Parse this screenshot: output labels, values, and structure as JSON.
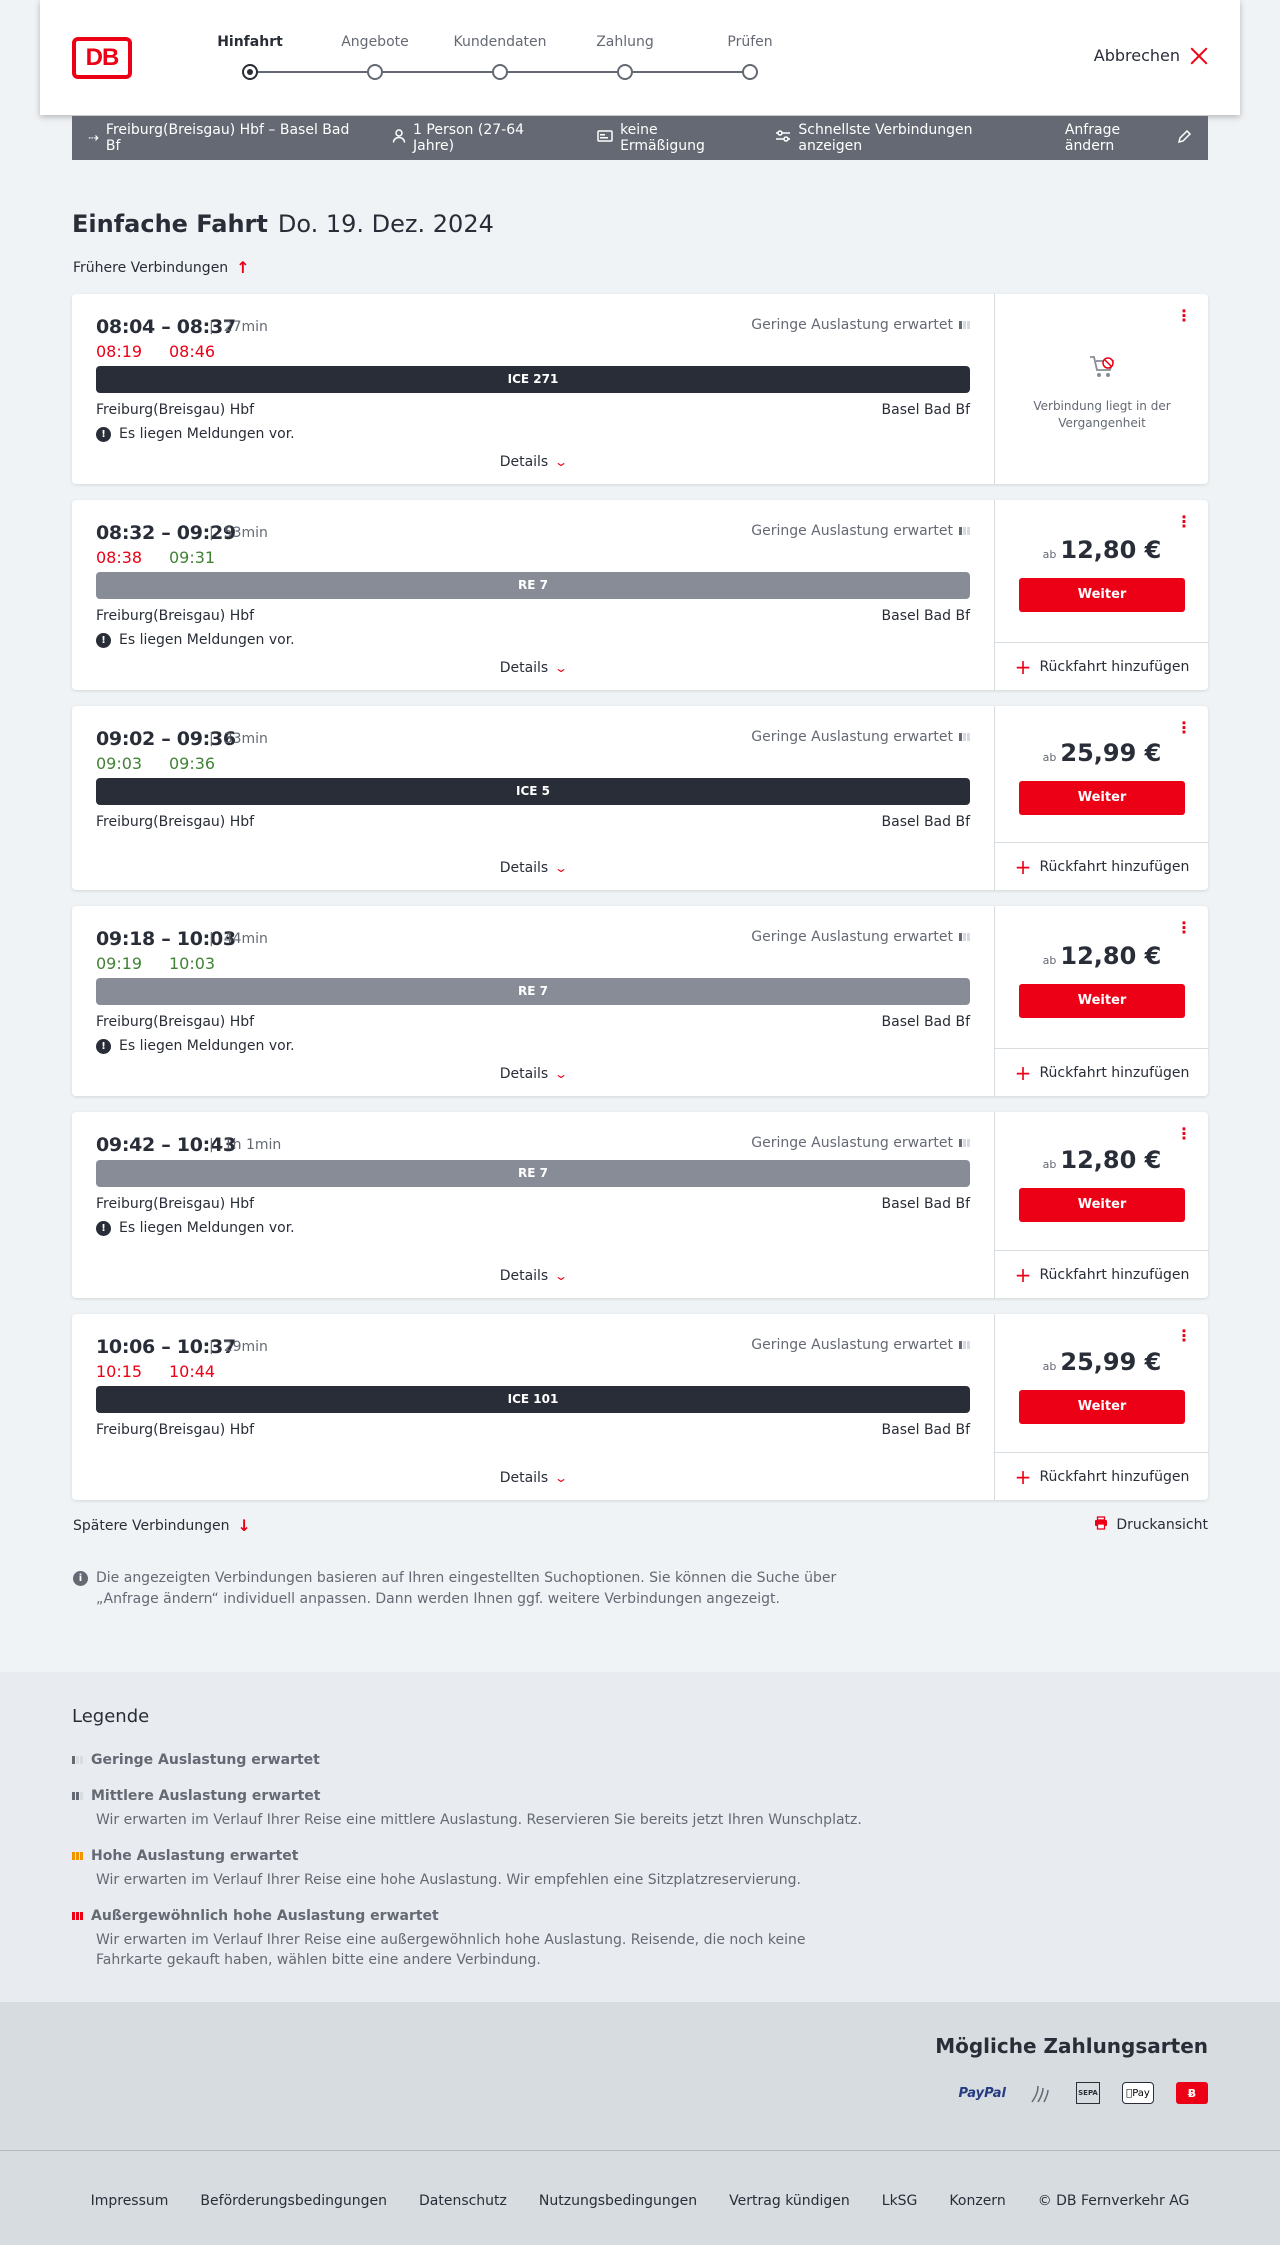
{
  "header": {
    "logo": "DB",
    "steps": [
      "Hinfahrt",
      "Angebote",
      "Kundendaten",
      "Zahlung",
      "Prüfen"
    ],
    "cancel_label": "Abbrechen"
  },
  "query": {
    "route": "Freiburg(Breisgau) Hbf – Basel Bad Bf",
    "passengers": "1 Person (27-64 Jahre)",
    "discount": "keine Ermäßigung",
    "fastest": "Schnellste Verbindungen anzeigen",
    "edit_label": "Anfrage ändern"
  },
  "page": {
    "title_type": "Einfache Fahrt",
    "title_date": "Do. 19. Dez. 2024",
    "earlier_label": "Frühere Verbindungen",
    "later_label": "Spätere Verbindungen",
    "print_label": "Druckansicht",
    "info_text": "Die angezeigten Verbindungen basieren auf Ihren eingestellten Suchoptionen. Sie können die Suche über „Anfrage ändern“ individuell anpassen. Dann werden Ihnen ggf. weitere Verbindungen angezeigt."
  },
  "common": {
    "load": "Geringe Auslastung erwartet",
    "from": "Freiburg(Breisgau) Hbf",
    "to": "Basel Bad Bf",
    "message": "Es liegen Meldungen vor.",
    "details": "Details",
    "price_prefix": "ab",
    "weiter": "Weiter",
    "return_label": "Rückfahrt hinzufügen",
    "past_label": "Verbindung liegt in der Vergangenheit"
  },
  "connections": [
    {
      "time": "08:04 – 08:37",
      "duration": "27min",
      "rt_dep": "08:19",
      "rt_arr": "08:46",
      "rt_color": "red",
      "train": "ICE 271",
      "train_style": "dark",
      "message": true,
      "past": true,
      "price": ""
    },
    {
      "time": "08:32 – 09:29",
      "duration": "53min",
      "rt_dep": "08:38",
      "rt_arr": "09:31",
      "rt_color": "mixed",
      "train": "RE 7",
      "train_style": "grey",
      "message": true,
      "past": false,
      "price": "12,80 €"
    },
    {
      "time": "09:02 – 09:36",
      "duration": "33min",
      "rt_dep": "09:03",
      "rt_arr": "09:36",
      "rt_color": "green",
      "train": "ICE 5",
      "train_style": "dark",
      "message": false,
      "past": false,
      "price": "25,99 €"
    },
    {
      "time": "09:18 – 10:03",
      "duration": "44min",
      "rt_dep": "09:19",
      "rt_arr": "10:03",
      "rt_color": "green",
      "train": "RE 7",
      "train_style": "grey",
      "message": true,
      "past": false,
      "price": "12,80 €"
    },
    {
      "time": "09:42 – 10:43",
      "duration": "1h 1min",
      "rt_dep": "",
      "rt_arr": "",
      "rt_color": "none",
      "train": "RE 7",
      "train_style": "grey",
      "message": true,
      "past": false,
      "price": "12,80 €"
    },
    {
      "time": "10:06 – 10:37",
      "duration": "29min",
      "rt_dep": "10:15",
      "rt_arr": "10:44",
      "rt_color": "red",
      "train": "ICE 101",
      "train_style": "dark",
      "message": false,
      "past": false,
      "price": "25,99 €"
    }
  ],
  "legend": {
    "title": "Legende",
    "items": [
      {
        "label": "Geringe Auslastung erwartet",
        "desc": ""
      },
      {
        "label": "Mittlere Auslastung erwartet",
        "desc": "Wir erwarten im Verlauf Ihrer Reise eine mittlere Auslastung. Reservieren Sie bereits jetzt Ihren Wunschplatz."
      },
      {
        "label": "Hohe Auslastung erwartet",
        "desc": "Wir erwarten im Verlauf Ihrer Reise eine hohe Auslastung. Wir empfehlen eine Sitzplatzreservierung."
      },
      {
        "label": "Außergewöhnlich hohe Auslastung erwartet",
        "desc": "Wir erwarten im Verlauf Ihrer Reise eine außergewöhnlich hohe Auslastung. Reisende, die noch keine Fahrkarte gekauft haben, wählen bitte eine andere Verbindung."
      }
    ]
  },
  "payment": {
    "title": "Mögliche Zahlungsarten",
    "paypal": "PayPal",
    "sepa": "SEPA",
    "applepay": "Pay"
  },
  "footer": {
    "links": [
      "Impressum",
      "Beförderungsbedingungen",
      "Datenschutz",
      "Nutzungsbedingungen",
      "Vertrag kündigen",
      "LkSG",
      "Konzern",
      "© DB Fernverkehr AG"
    ]
  },
  "colors": {
    "accent": "#ec0016",
    "dark": "#282d37",
    "grey": "#646973",
    "green": "#408335",
    "orange": "#f39200"
  }
}
